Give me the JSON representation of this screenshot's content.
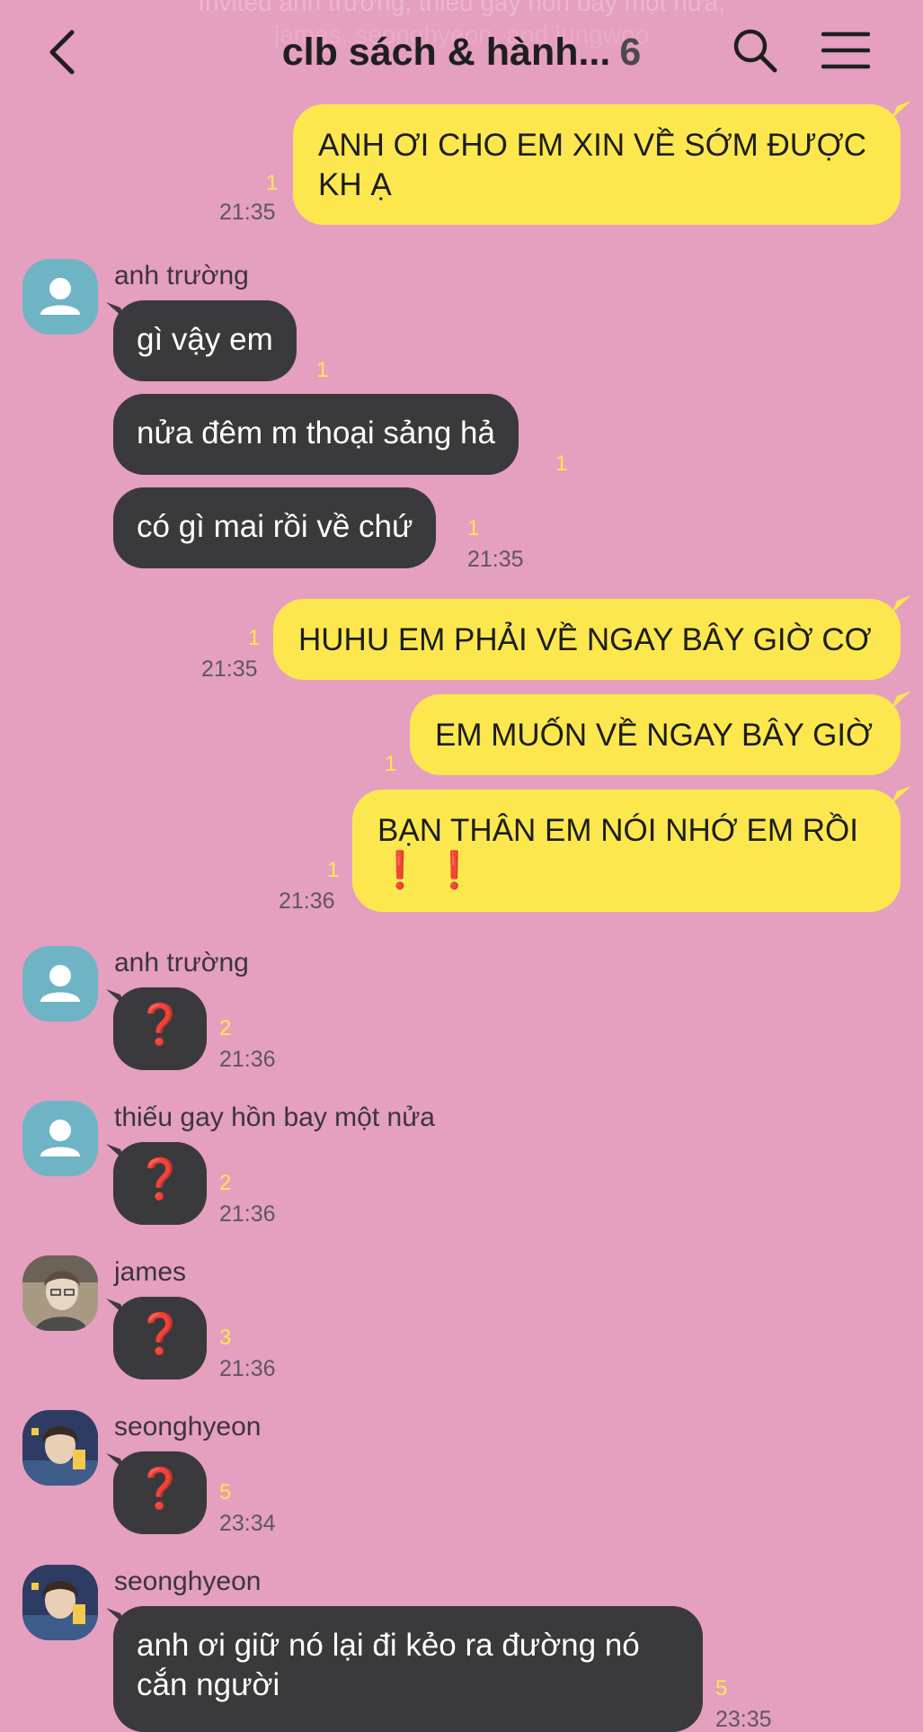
{
  "header": {
    "faded_system_line1": "Invited anh trường, thiếu gay hồn bay một nửa,",
    "faded_system_line2": "james, seonghyeon, and jungwoo",
    "title": "clb sách & hành...",
    "member_count": "6"
  },
  "messages": [
    {
      "from": "me",
      "text": "ANH ƠI CHO EM XIN VỀ SỚM ĐƯỢC KH Ạ",
      "unread": "1",
      "time": "21:35"
    },
    {
      "from": "anh trường",
      "avatar": "default",
      "text": "gì vậy em",
      "unread": "1",
      "time": ""
    },
    {
      "from": "anh trường",
      "text": "nửa đêm m thoại sảng hả",
      "unread": "1",
      "time": ""
    },
    {
      "from": "anh trường",
      "text": "có gì mai rồi về chứ",
      "unread": "1",
      "time": "21:35"
    },
    {
      "from": "me",
      "text": "HUHU EM PHẢI VỀ NGAY BÂY GIỜ CƠ",
      "unread": "1",
      "time": "21:35"
    },
    {
      "from": "me",
      "text": "EM MUỐN VỀ NGAY BÂY GIỜ",
      "unread": "1",
      "time": ""
    },
    {
      "from": "me",
      "text": "BẠN THÂN EM NÓI NHỚ EM RỒI",
      "emoji": "❗ ❗",
      "unread": "1",
      "time": "21:36"
    },
    {
      "from": "anh trường",
      "avatar": "default",
      "text": "❓",
      "unread": "2",
      "time": "21:36"
    },
    {
      "from": "thiếu gay hồn bay một nửa",
      "avatar": "default",
      "text": "❓",
      "unread": "2",
      "time": "21:36"
    },
    {
      "from": "james",
      "avatar": "photo-james",
      "text": "❓",
      "unread": "3",
      "time": "21:36"
    },
    {
      "from": "seonghyeon",
      "avatar": "photo-seonghyeon",
      "text": "❓",
      "unread": "5",
      "time": "23:34"
    },
    {
      "from": "seonghyeon",
      "avatar": "photo-seonghyeon",
      "text": "anh ơi giữ nó lại đi kẻo ra đường nó cắn người",
      "unread": "5",
      "time": "23:35"
    }
  ],
  "colors": {
    "background": "#e59fbf",
    "my_bubble": "#fce84e",
    "their_bubble": "#3a3a3d",
    "unread_count": "#fce84e",
    "default_avatar": "#6fb4c4"
  }
}
